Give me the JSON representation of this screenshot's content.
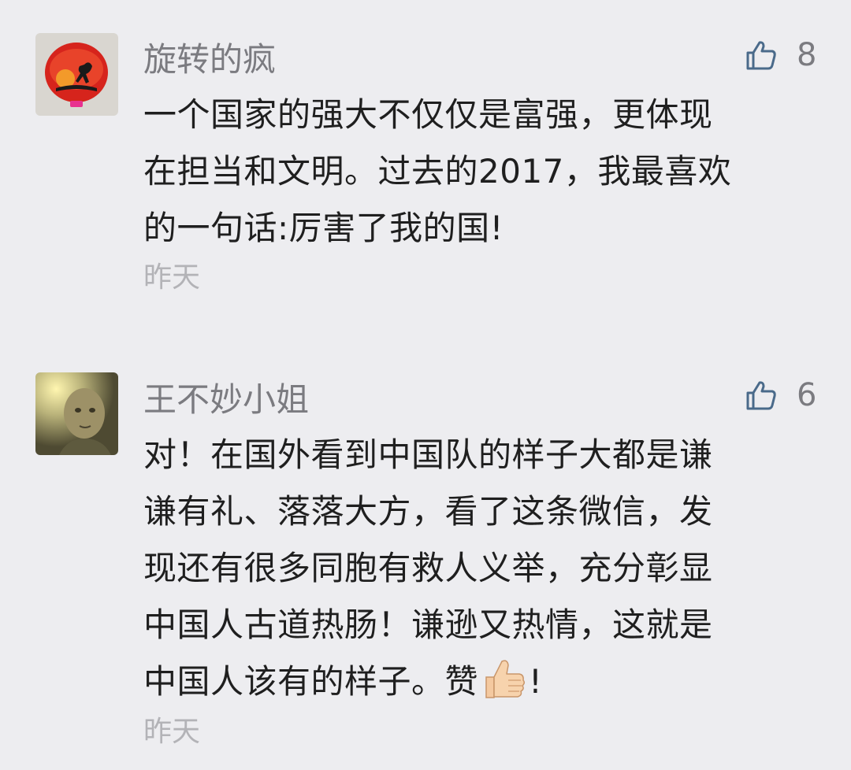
{
  "comments": [
    {
      "author": "旋转的疯",
      "likes": "8",
      "lines": [
        "一个国家的强大不仅仅是富强，更体现",
        "在担当和文明。过去的2017，我最喜欢",
        "的一句话:厉害了我的国!"
      ],
      "time": "昨天",
      "avatar_icon": "red-lantern-silhouette-avatar"
    },
    {
      "author": "王不妙小姐",
      "likes": "6",
      "lines": [
        "对！在国外看到中国队的样子大都是谦",
        "谦有礼、落落大方，看了这条微信，发",
        "现还有很多同胞有救人义举，充分彰显",
        "中国人古道热肠！谦逊又热情，这就是"
      ],
      "last_line_before_emoji": "中国人该有的样子。赞",
      "last_line_after_emoji": "!",
      "time": "昨天",
      "avatar_icon": "vintage-child-portrait-avatar"
    }
  ],
  "icons": {
    "like": "thumbs-up-outline-icon",
    "emoji": "thumbs-up-emoji"
  },
  "colors": {
    "background": "#ededf0",
    "name": "#7b7b80",
    "text": "#1f1f1f",
    "time": "#b3b3b7",
    "like_icon": "#4a6a8a"
  }
}
